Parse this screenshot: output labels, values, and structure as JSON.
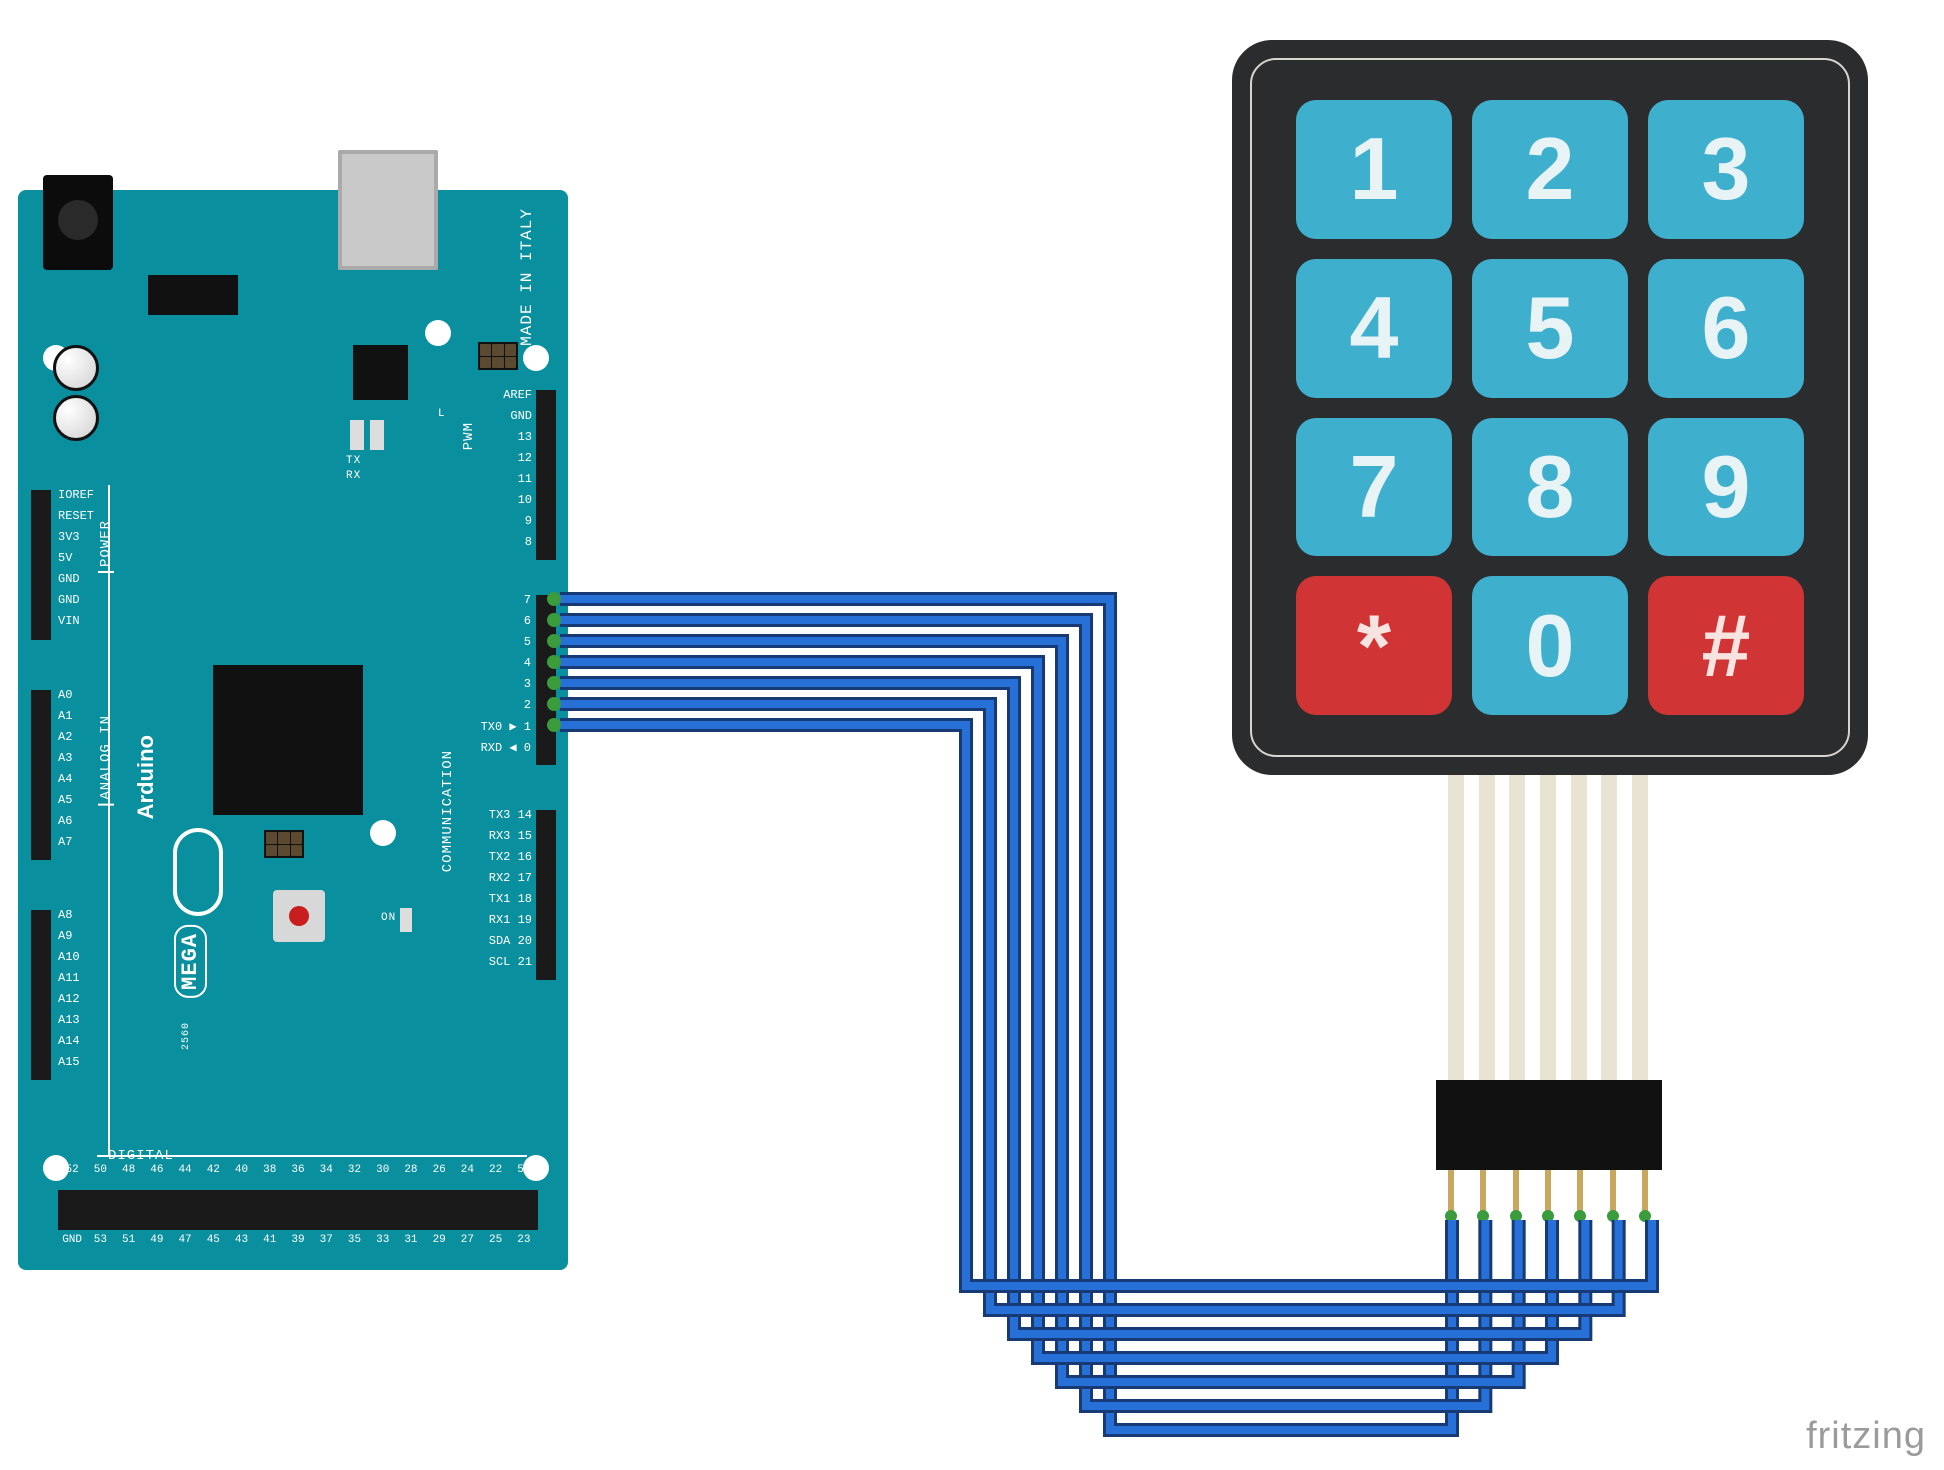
{
  "arduino": {
    "made_in": "MADE IN\nITALY",
    "brand": "Arduino",
    "model": "MEGA",
    "model_sub": "2560",
    "sections": {
      "power": "POWER",
      "analog": "ANALOG IN",
      "communication": "COMMUNICATION",
      "digital": "DIGITAL",
      "pwm": "PWM"
    },
    "leds": {
      "tx": "TX",
      "rx": "RX",
      "l": "L",
      "on": "ON"
    },
    "left_header_power": [
      "IOREF",
      "RESET",
      "3V3",
      "5V",
      "GND",
      "GND",
      "VIN"
    ],
    "left_header_analog_a": [
      "A0",
      "A1",
      "A2",
      "A3",
      "A4",
      "A5",
      "A6",
      "A7"
    ],
    "left_header_analog_b": [
      "A8",
      "A9",
      "A10",
      "A11",
      "A12",
      "A13",
      "A14",
      "A15"
    ],
    "right_header_top": [
      "AREF",
      "GND",
      "13",
      "12",
      "11",
      "10",
      "9",
      "8"
    ],
    "right_header_digital": [
      "7",
      "6",
      "5",
      "4",
      "3",
      "2",
      "1",
      "0"
    ],
    "right_header_txrx": [
      "TX0 ▶",
      "RXD ◀"
    ],
    "right_header_comm": [
      "TX3 14",
      "RX3 15",
      "TX2 16",
      "RX2 17",
      "TX1 18",
      "RX1 19",
      "SDA 20",
      "SCL 21"
    ],
    "bottom_header_top": [
      "52",
      "50",
      "48",
      "46",
      "44",
      "42",
      "40",
      "38",
      "36",
      "34",
      "32",
      "30",
      "28",
      "26",
      "24",
      "22",
      "5V"
    ],
    "bottom_header_bot": [
      "GND",
      "53",
      "51",
      "49",
      "47",
      "45",
      "43",
      "41",
      "39",
      "37",
      "35",
      "33",
      "31",
      "29",
      "27",
      "25",
      "23"
    ]
  },
  "keypad": {
    "keys": [
      [
        "1",
        "2",
        "3"
      ],
      [
        "4",
        "5",
        "6"
      ],
      [
        "7",
        "8",
        "9"
      ],
      [
        "*",
        "0",
        "#"
      ]
    ],
    "pin_count": 7
  },
  "wiring": {
    "description": "7 jumper wires connect Arduino Mega digital pins 1 through 7 to the 7 output pins of the 4x3 membrane keypad connector.",
    "connections": [
      {
        "arduino_pin": "7",
        "keypad_pin": 1
      },
      {
        "arduino_pin": "6",
        "keypad_pin": 2
      },
      {
        "arduino_pin": "5",
        "keypad_pin": 3
      },
      {
        "arduino_pin": "4",
        "keypad_pin": 4
      },
      {
        "arduino_pin": "3",
        "keypad_pin": 5
      },
      {
        "arduino_pin": "2",
        "keypad_pin": 6
      },
      {
        "arduino_pin": "1",
        "keypad_pin": 7
      }
    ]
  },
  "credit": "fritzing"
}
